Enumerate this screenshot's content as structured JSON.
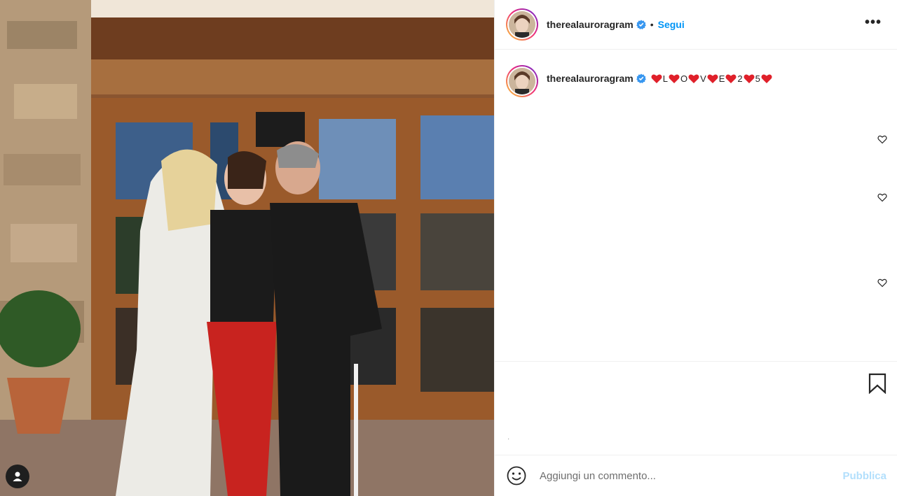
{
  "post": {
    "author": {
      "username": "therealauroragram",
      "verified": true,
      "avatar_icon": "profile-avatar"
    },
    "follow_label": "Segui",
    "separator": "•",
    "more_label": "•••",
    "caption": {
      "username": "therealauroragram",
      "segments": [
        "L",
        "O",
        "V",
        "E",
        "2",
        "5"
      ],
      "heart_icon": "red-heart-emoji",
      "heart_color": "#e0202a"
    },
    "photo_icon": "user-tag-icon",
    "actions": {
      "bookmark_icon": "bookmark-icon",
      "like_icon": "heart-outline-icon",
      "caption_dot": "·"
    },
    "comment": {
      "placeholder": "Aggiungi un commento...",
      "submit_label": "Pubblica",
      "emoji_icon": "emoji-smile-icon"
    }
  },
  "colors": {
    "accent": "#0095f6",
    "publish_disabled": "#b2dffc",
    "verified": "#3897f0",
    "border": "#efefef"
  }
}
